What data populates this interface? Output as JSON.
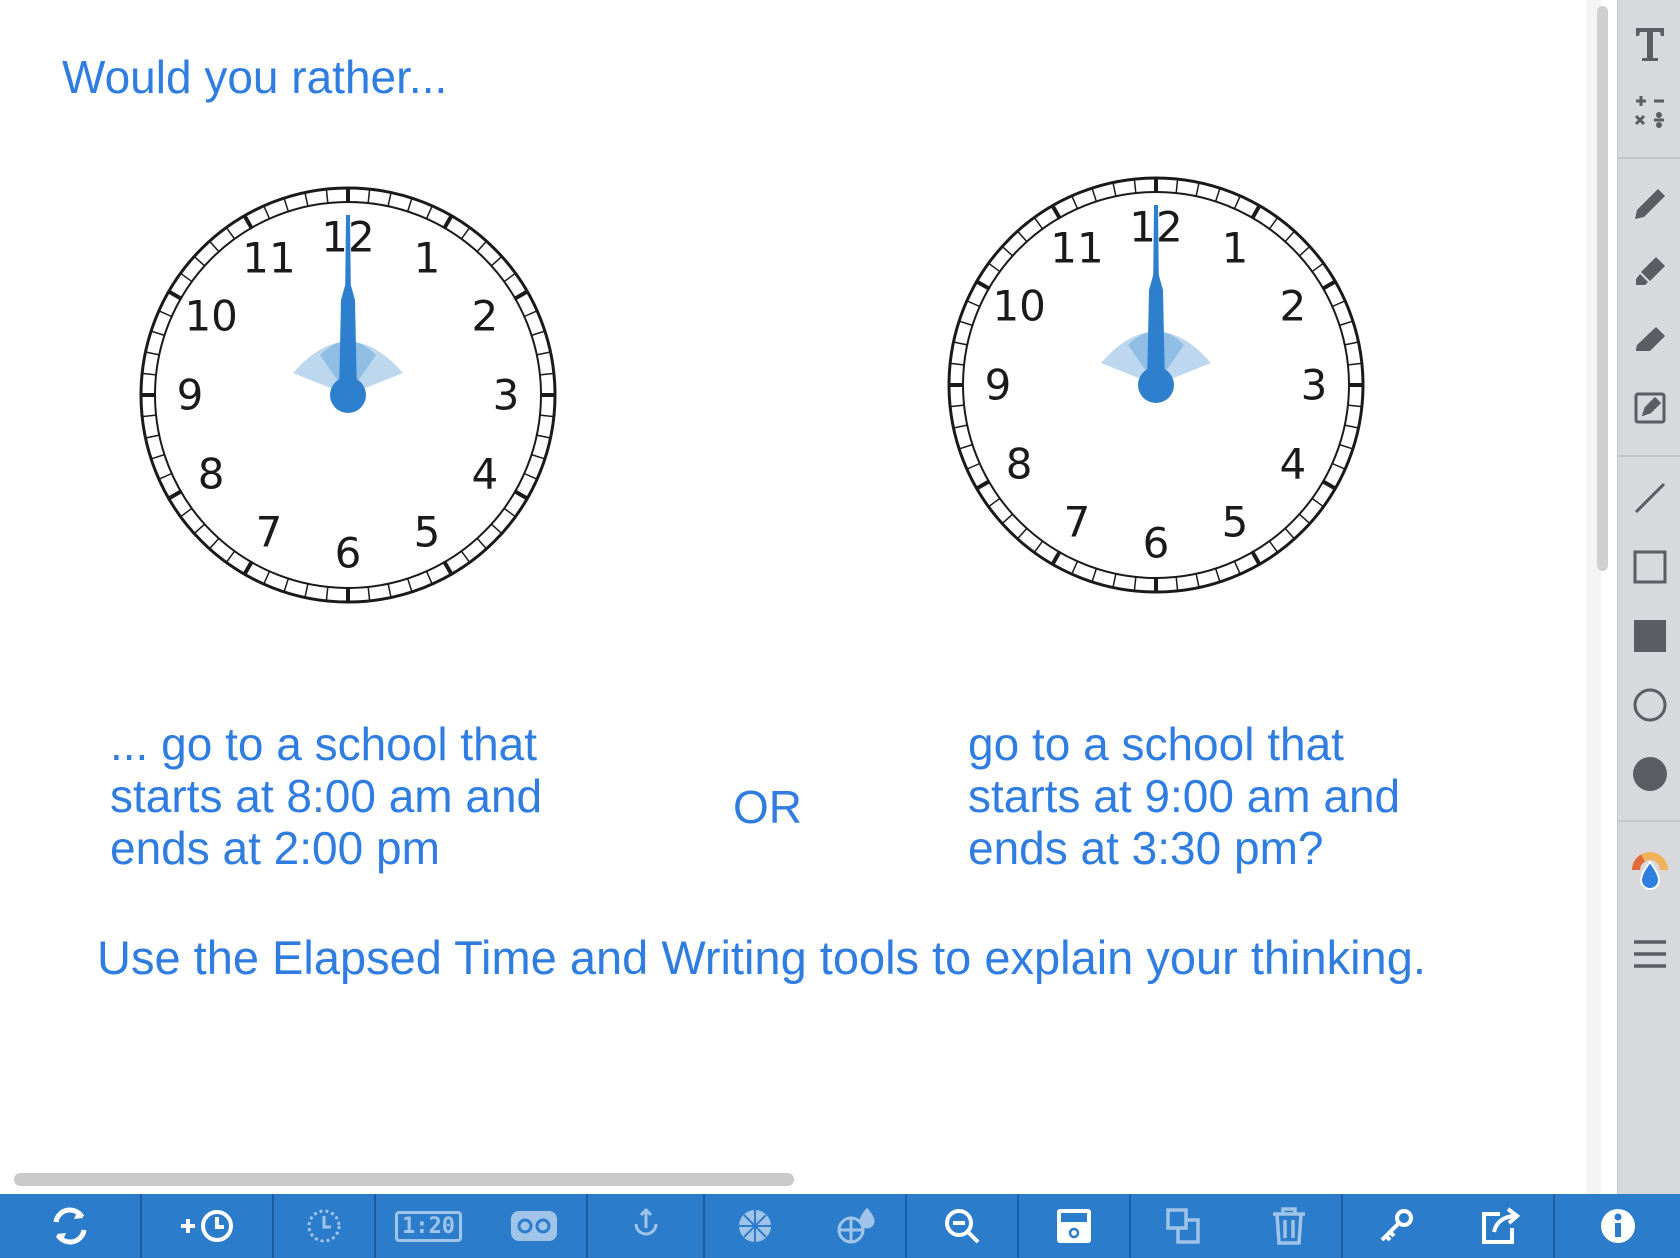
{
  "prompt": {
    "title": "Would you rather...",
    "choice_a": [
      "... go to a school that",
      "starts at 8:00 am and",
      "ends at 2:00 pm"
    ],
    "or_label": "OR",
    "choice_b": [
      "go to a school that",
      "starts at 9:00 am and",
      "ends at 3:30 pm?"
    ],
    "instruction": "Use the Elapsed Time and Writing tools to explain your thinking."
  },
  "clocks": [
    {
      "name": "clock-a",
      "numbers": [
        "12",
        "1",
        "2",
        "3",
        "4",
        "5",
        "6",
        "7",
        "8",
        "9",
        "10",
        "11"
      ],
      "time": "12:00"
    },
    {
      "name": "clock-b",
      "numbers": [
        "12",
        "1",
        "2",
        "3",
        "4",
        "5",
        "6",
        "7",
        "8",
        "9",
        "10",
        "11"
      ],
      "time": "12:00"
    }
  ],
  "colors": {
    "accent_text": "#2f7de1",
    "clock_hand": "#2f7fcf",
    "toolbar": "#2c7ccc",
    "tool_panel": "#d7d9dc"
  },
  "right_tools": [
    {
      "name": "text-tool-icon"
    },
    {
      "name": "math-tool-icon"
    },
    {
      "name": "pen-tool-icon"
    },
    {
      "name": "marker-tool-icon"
    },
    {
      "name": "eraser-tool-icon"
    },
    {
      "name": "note-tool-icon"
    },
    {
      "name": "line-tool-icon"
    },
    {
      "name": "rectangle-outline-icon"
    },
    {
      "name": "rectangle-filled-icon"
    },
    {
      "name": "circle-outline-icon"
    },
    {
      "name": "circle-filled-icon"
    },
    {
      "name": "color-picker-icon"
    },
    {
      "name": "menu-icon"
    }
  ],
  "bottom_tools": {
    "digital_readout": "1:20",
    "icons": [
      "reset-icon",
      "add-clock-icon",
      "clock-face-icon",
      "digital-clock-icon",
      "elapsed-time-icon",
      "drag-icon",
      "fraction-icon",
      "fill-icon",
      "zoom-out-icon",
      "save-icon",
      "duplicate-icon",
      "trash-icon",
      "key-icon",
      "share-icon",
      "info-icon"
    ]
  }
}
